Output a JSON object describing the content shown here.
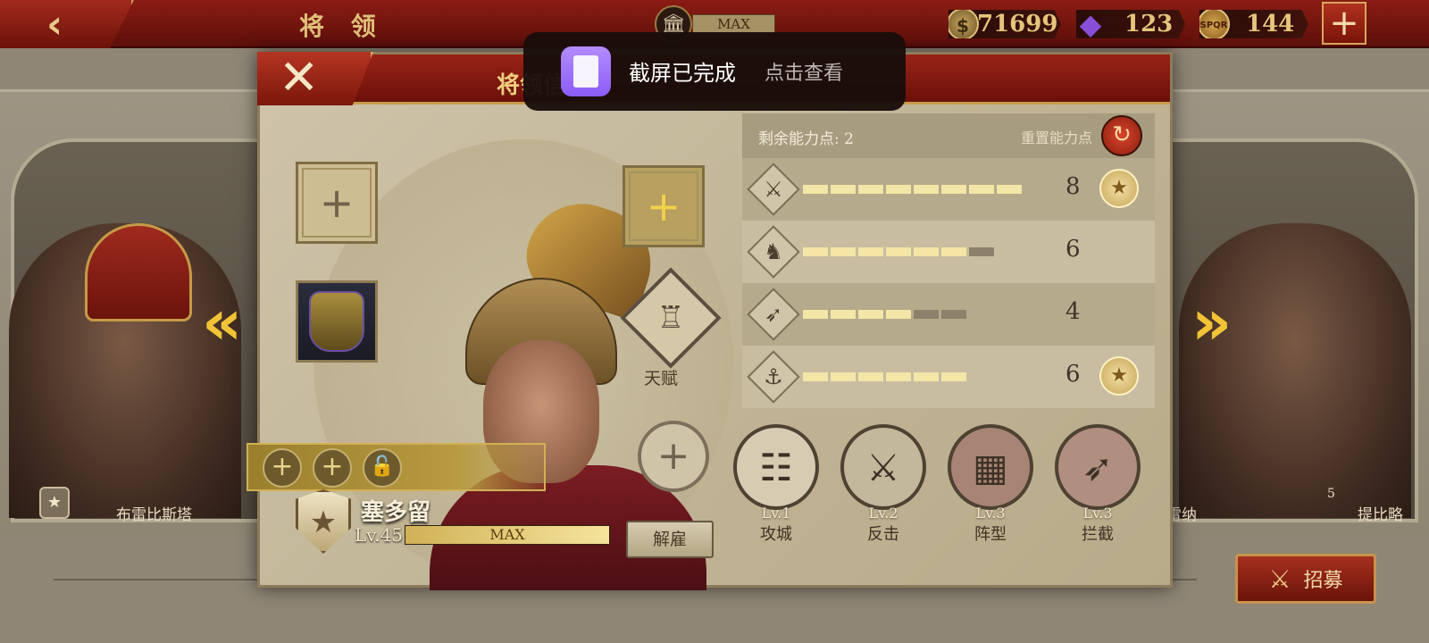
{
  "topbar": {
    "back_icon": "chevron-left-icon",
    "title": "将 领",
    "building_icon": "temple-icon",
    "building_status": "MAX",
    "coins": "71699",
    "gems": "123",
    "spqr": "144",
    "add_label": "+"
  },
  "side_heroes": {
    "left_name": "布雷比斯塔",
    "right_name_partial": "雷纳",
    "right_name": "提比略",
    "right_level": "5"
  },
  "recruit_label": "招募",
  "panel": {
    "close_label": "✕",
    "title": "将领信",
    "hero": {
      "name": "塞多留",
      "level": "Lv.45",
      "level_status": "MAX",
      "dismiss_label": "解雇",
      "talent_label": "天赋"
    },
    "stats": {
      "remaining_label": "剩余能力点: 2",
      "reset_label": "重置能力点",
      "rows": [
        {
          "icon": "sword-icon",
          "value": "8",
          "filled": 8,
          "max": 8,
          "medal": true
        },
        {
          "icon": "horse-icon",
          "value": "6",
          "filled": 6,
          "max": 7,
          "medal": false
        },
        {
          "icon": "bow-icon",
          "value": "4",
          "filled": 4,
          "max": 6,
          "medal": false
        },
        {
          "icon": "anchor-icon",
          "value": "6",
          "filled": 6,
          "max": 6,
          "medal": true
        }
      ]
    },
    "skills": [
      {
        "level": "Lv.1",
        "name": "攻城"
      },
      {
        "level": "Lv.2",
        "name": "反击"
      },
      {
        "level": "Lv.3",
        "name": "阵型"
      },
      {
        "level": "Lv.3",
        "name": "拦截"
      }
    ]
  },
  "toast": {
    "title": "截屏已完成",
    "action": "点击查看"
  },
  "colors": {
    "accent_red": "#8a1c14",
    "gold": "#e6c57c",
    "bar_fill": "#f3e6a6"
  }
}
